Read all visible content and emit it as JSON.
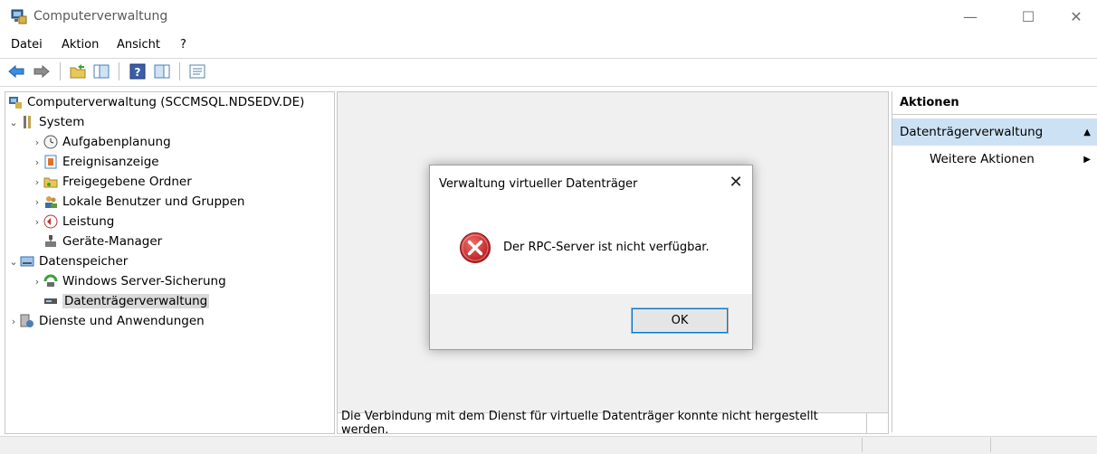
{
  "window": {
    "title": "Computerverwaltung",
    "minimize": "—",
    "maximize": "☐",
    "close": "✕"
  },
  "menu": {
    "items": [
      "Datei",
      "Aktion",
      "Ansicht",
      "?"
    ]
  },
  "tree": {
    "root": "Computerverwaltung (SCCMSQL.NDSEDV.DE)",
    "system": "System",
    "system_children": [
      "Aufgabenplanung",
      "Ereignisanzeige",
      "Freigegebene Ordner",
      "Lokale Benutzer und Gruppen",
      "Leistung",
      "Geräte-Manager"
    ],
    "storage": "Datenspeicher",
    "storage_children": [
      "Windows Server-Sicherung",
      "Datenträgerverwaltung"
    ],
    "services": "Dienste und Anwendungen"
  },
  "center": {
    "status_text": "Die Verbindung mit dem Dienst für virtuelle Datenträger konnte nicht hergestellt werden."
  },
  "actions": {
    "header": "Aktionen",
    "section": "Datenträgerverwaltung",
    "more": "Weitere Aktionen"
  },
  "dialog": {
    "title": "Verwaltung virtueller Datenträger",
    "message": "Der RPC-Server ist nicht verfügbar.",
    "ok_label": "OK",
    "close": "✕"
  },
  "colors": {
    "accent_selection": "#cde1f4",
    "error_red": "#d32f2f",
    "focus_blue": "#0078d7"
  }
}
